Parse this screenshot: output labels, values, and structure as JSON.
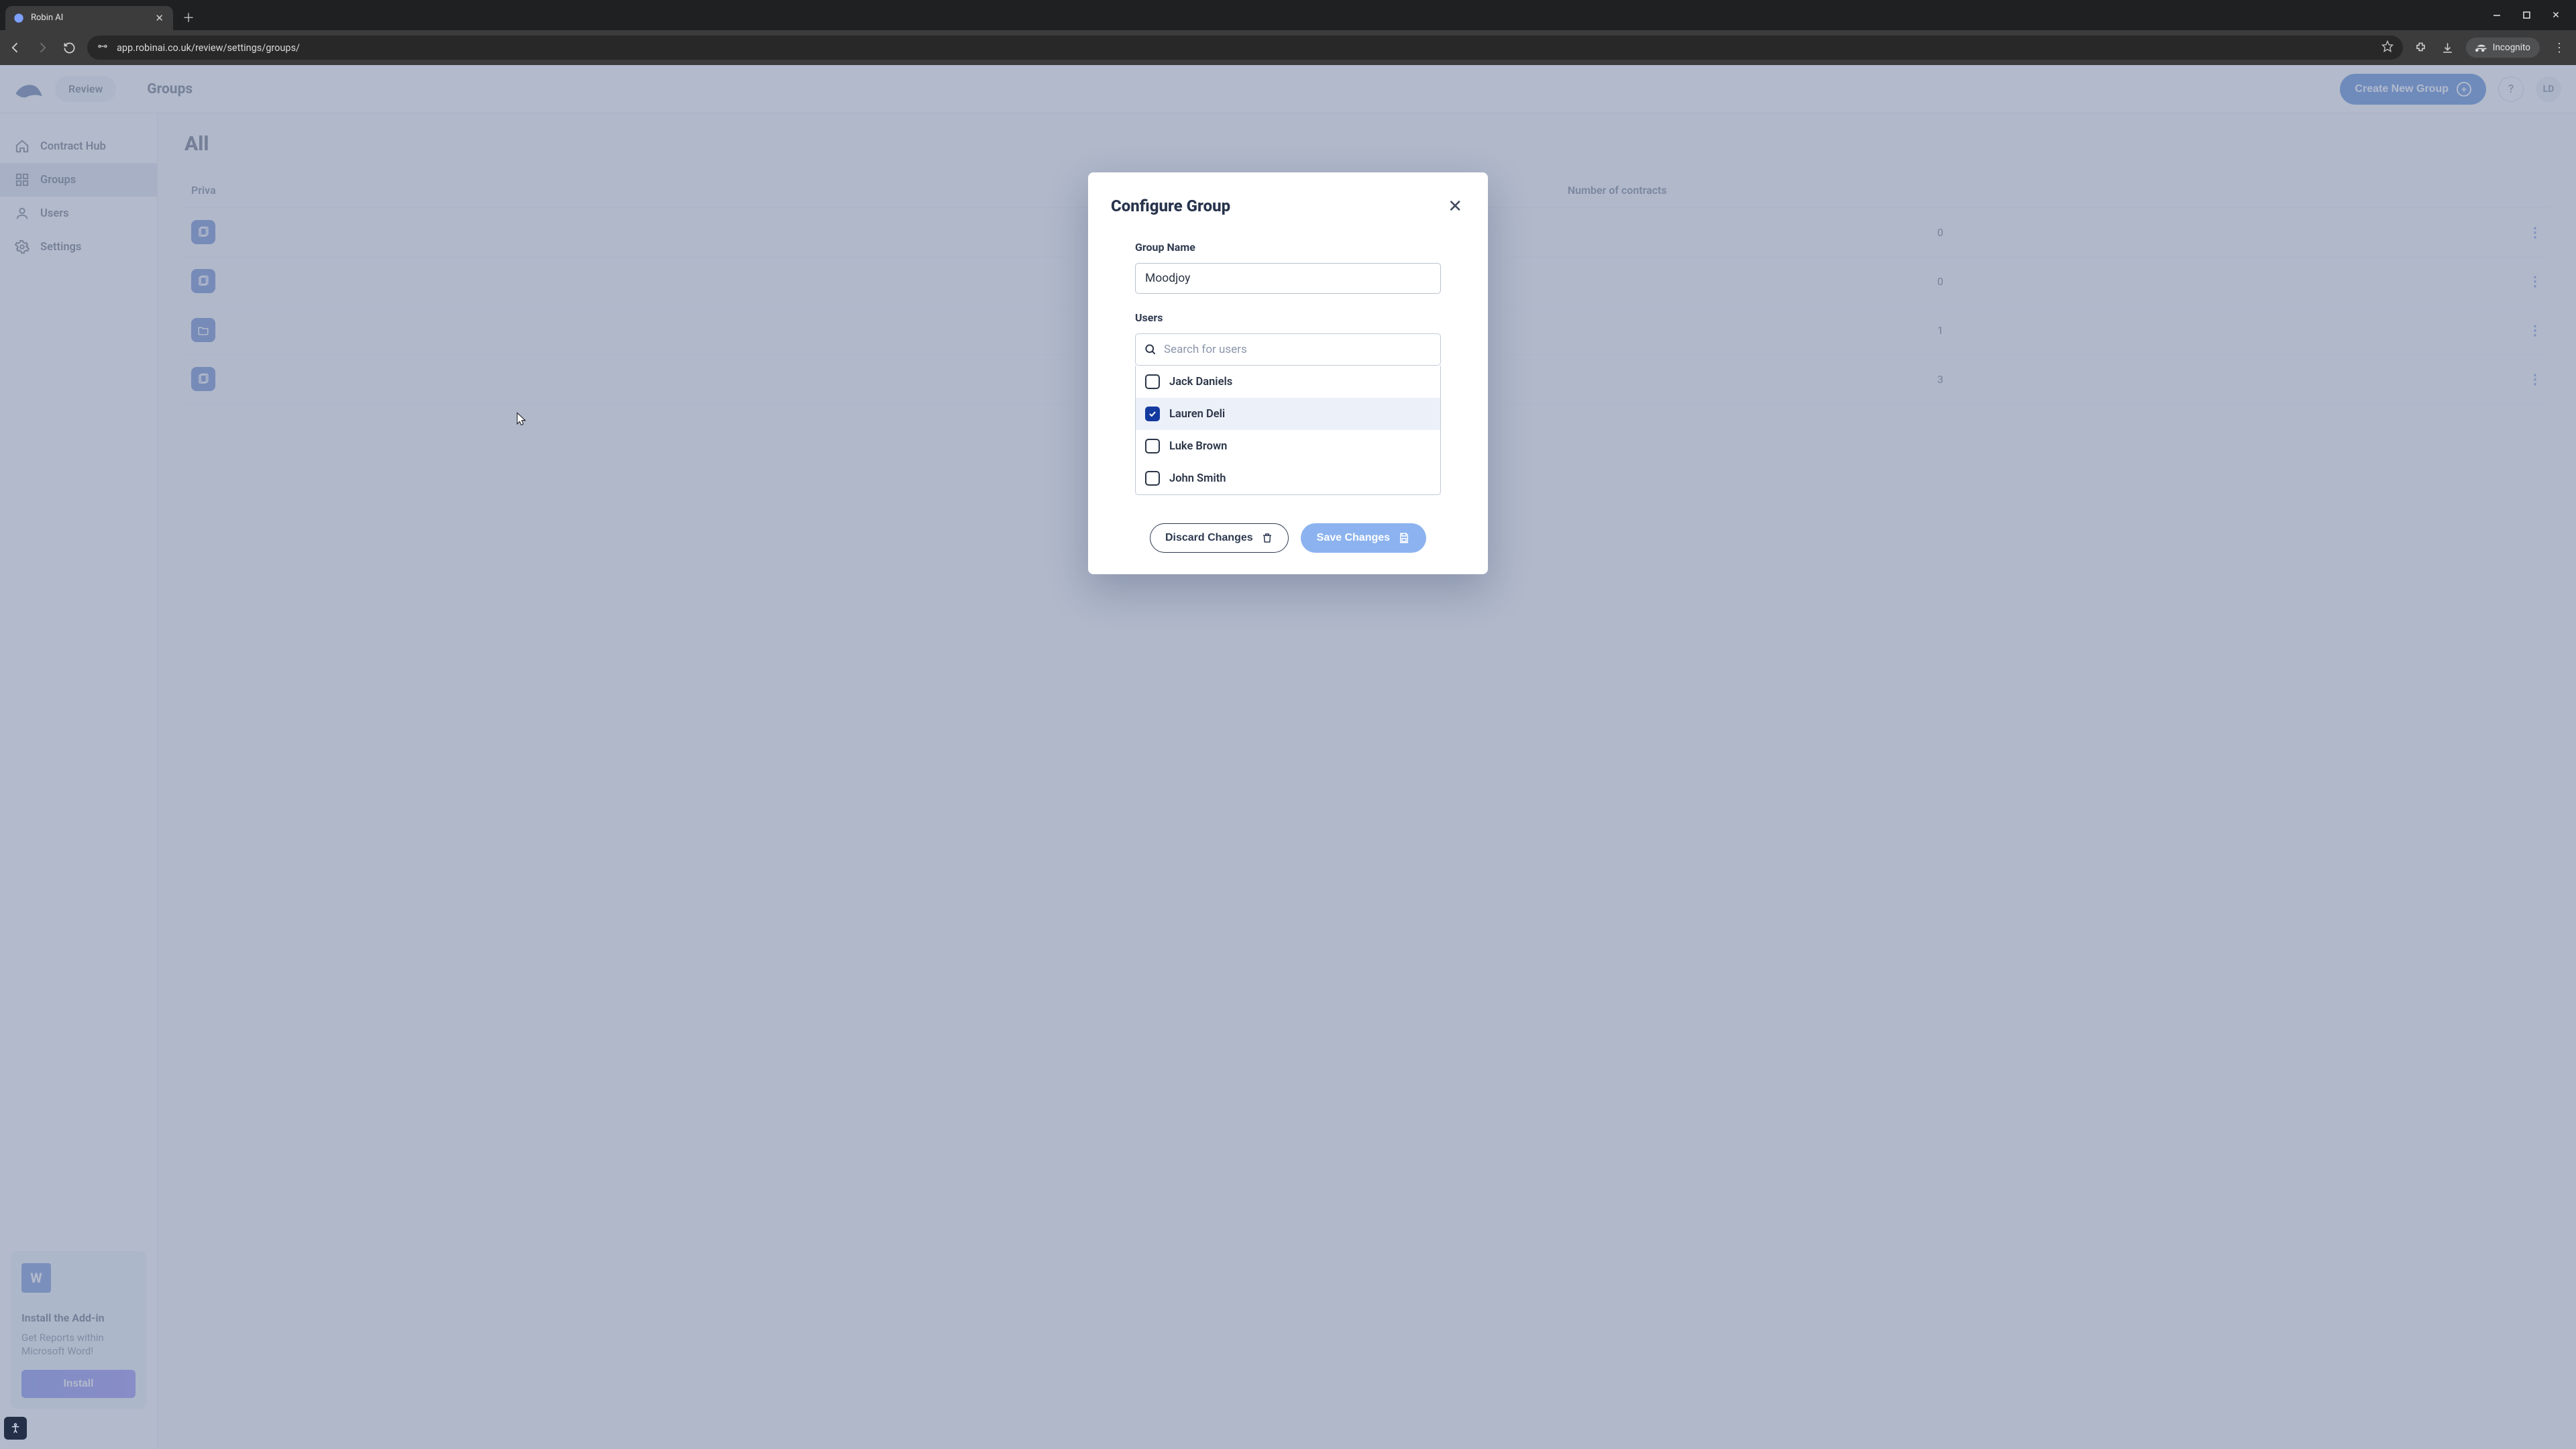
{
  "browser": {
    "tab_title": "Robin AI",
    "url": "app.robinai.co.uk/review/settings/groups/",
    "incognito_label": "Incognito"
  },
  "header": {
    "active_tab": "Review",
    "page_name": "Groups",
    "new_group_btn": "Create New Group",
    "avatar_initials": "LD"
  },
  "sidebar": {
    "items": [
      {
        "label": "Contract Hub",
        "icon": "home-icon",
        "active": false
      },
      {
        "label": "Groups",
        "icon": "grid-icon",
        "active": true
      },
      {
        "label": "Users",
        "icon": "user-icon",
        "active": false
      },
      {
        "label": "Settings",
        "icon": "gear-icon",
        "active": false
      }
    ],
    "addin": {
      "title": "Install the Add-in",
      "subtitle": "Get Reports within Microsoft Word!",
      "button": "Install"
    }
  },
  "groups_page": {
    "heading": "All",
    "columns": {
      "name": "Priva",
      "users": "",
      "contracts": "Number of contracts"
    },
    "rows": [
      {
        "contracts": 0
      },
      {
        "contracts": 0
      },
      {
        "contracts": 1
      },
      {
        "contracts": 3
      }
    ]
  },
  "modal": {
    "title": "Configure Group",
    "group_name_label": "Group Name",
    "group_name_value": "Moodjoy",
    "users_label": "Users",
    "search_placeholder": "Search for users",
    "users": [
      {
        "name": "Jack Daniels",
        "checked": false,
        "hover": false
      },
      {
        "name": "Lauren Deli",
        "checked": true,
        "hover": true
      },
      {
        "name": "Luke Brown",
        "checked": false,
        "hover": false
      },
      {
        "name": "John Smith",
        "checked": false,
        "hover": false
      }
    ],
    "discard_label": "Discard Changes",
    "save_label": "Save Changes"
  }
}
